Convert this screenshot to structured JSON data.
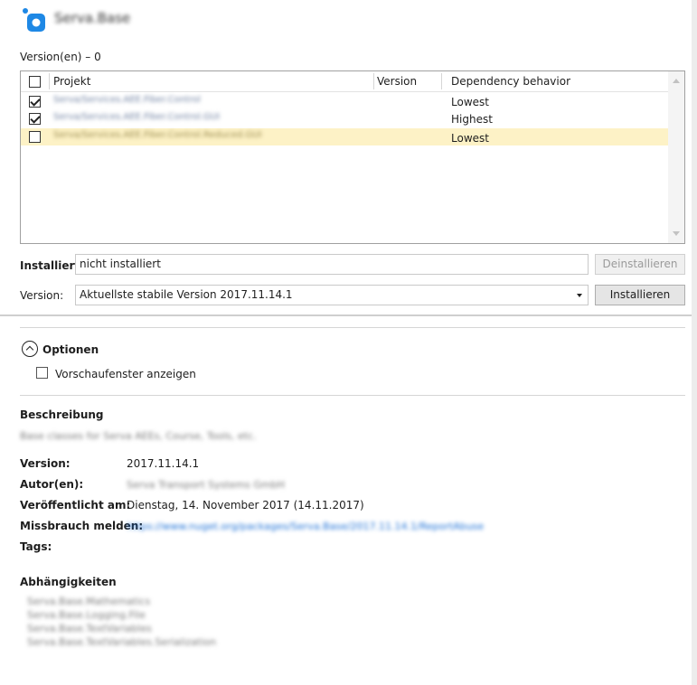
{
  "header": {
    "package_name": "Serva.Base",
    "logo_color": "#1e88e5"
  },
  "versions_label": "Version(en) – 0",
  "project_table": {
    "headers": {
      "project": "Projekt",
      "version": "Version",
      "dependency": "Dependency behavior"
    },
    "rows": [
      {
        "checked": true,
        "project": "Serva/Services.AEE.Fiber.Control",
        "version": "",
        "dependency": "Lowest"
      },
      {
        "checked": true,
        "project": "Serva/Services.AEE.Fiber.Control.GUI",
        "version": "",
        "dependency": "Highest"
      },
      {
        "checked": false,
        "project": "Serva/Services.AEE.Fiber.Control.Reduced.GUI",
        "version": "",
        "dependency": "Lowest",
        "selected": true
      }
    ]
  },
  "installed": {
    "label": "Installiert:",
    "value": "nicht installiert",
    "uninstall_button": "Deinstallieren"
  },
  "version_select": {
    "label": "Version:",
    "value": "Aktuellste stabile Version 2017.11.14.1",
    "install_button": "Installieren"
  },
  "options": {
    "title": "Optionen",
    "preview_label": "Vorschaufenster anzeigen"
  },
  "description": {
    "title": "Beschreibung",
    "text": "Base classes for Serva AEEs, Course, Tools, etc."
  },
  "details": {
    "version_label": "Version:",
    "version_value": "2017.11.14.1",
    "authors_label": "Autor(en):",
    "authors_value": "Serva Transport Systems GmbH",
    "published_label": "Veröffentlicht am:",
    "published_value": "Dienstag, 14. November 2017 (14.11.2017)",
    "report_label": "Missbrauch melden:",
    "report_value": "https://www.nuget.org/packages/Serva.Base/2017.11.14.1/ReportAbuse",
    "tags_label": "Tags:"
  },
  "dependencies": {
    "title": "Abhängigkeiten",
    "items": [
      "Serva.Base.Mathematics",
      "Serva.Base.Logging.File",
      "Serva.Base.TextVariables",
      "Serva.Base.TextVariables.Serialization"
    ]
  }
}
